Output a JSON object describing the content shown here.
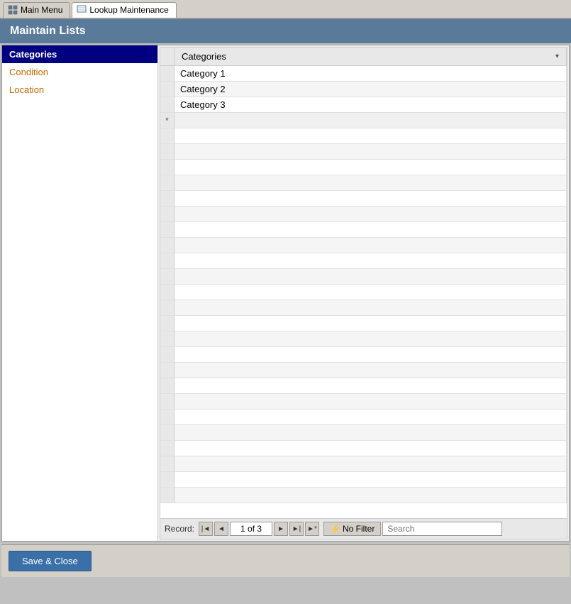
{
  "tabs": [
    {
      "id": "main-menu",
      "label": "Main Menu",
      "active": false,
      "icon": "grid-icon"
    },
    {
      "id": "lookup-maintenance",
      "label": "Lookup Maintenance",
      "active": true,
      "icon": "grid-icon"
    }
  ],
  "title": "Maintain Lists",
  "sidebar": {
    "items": [
      {
        "id": "categories",
        "label": "Categories",
        "selected": true,
        "style": "normal"
      },
      {
        "id": "condition",
        "label": "Condition",
        "selected": false,
        "style": "orange"
      },
      {
        "id": "location",
        "label": "Location",
        "selected": false,
        "style": "orange"
      }
    ]
  },
  "grid": {
    "column_header": "Categories",
    "rows": [
      {
        "id": 1,
        "value": "Category 1",
        "marker": ""
      },
      {
        "id": 2,
        "value": "Category 2",
        "marker": ""
      },
      {
        "id": 3,
        "value": "Category 3",
        "marker": ""
      }
    ],
    "new_row_marker": "*"
  },
  "nav": {
    "record_label": "Record:",
    "record_info": "1 of 3",
    "no_filter_label": "No Filter",
    "search_placeholder": "Search",
    "search_value": ""
  },
  "footer": {
    "save_close_label": "Save & Close"
  }
}
